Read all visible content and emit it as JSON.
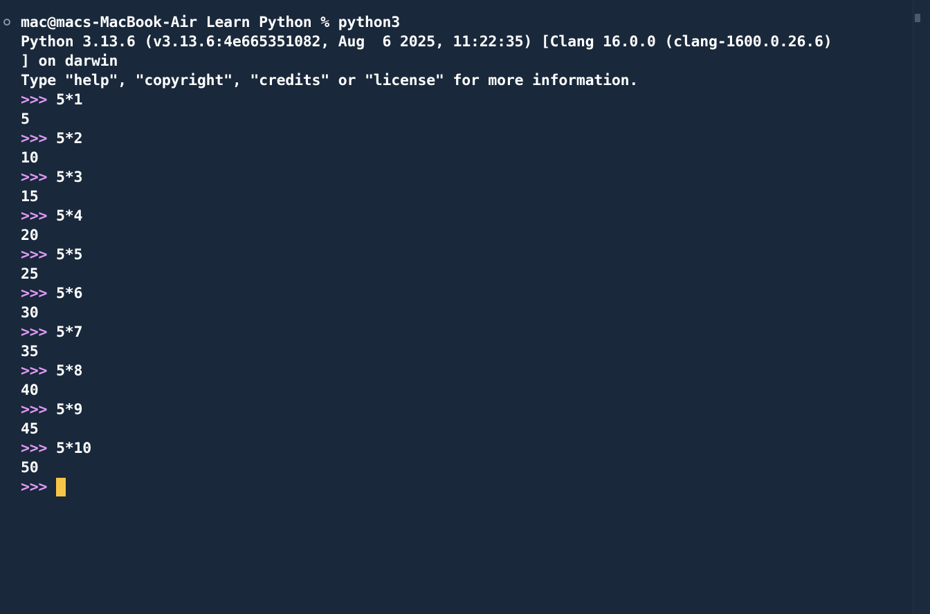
{
  "terminal": {
    "shell_prompt": "mac@macs-MacBook-Air Learn Python % python3",
    "banner_line1": "Python 3.13.6 (v3.13.6:4e665351082, Aug  6 2025, 11:22:35) [Clang 16.0.0 (clang-1600.0.26.6)",
    "banner_line2": "] on darwin",
    "banner_line3": "Type \"help\", \"copyright\", \"credits\" or \"license\" for more information.",
    "repl_prompt": ">>>",
    "entries": [
      {
        "input": "5*1",
        "output": "5"
      },
      {
        "input": "5*2",
        "output": "10"
      },
      {
        "input": "5*3",
        "output": "15"
      },
      {
        "input": "5*4",
        "output": "20"
      },
      {
        "input": "5*5",
        "output": "25"
      },
      {
        "input": "5*6",
        "output": "30"
      },
      {
        "input": "5*7",
        "output": "35"
      },
      {
        "input": "5*8",
        "output": "40"
      },
      {
        "input": "5*9",
        "output": "45"
      },
      {
        "input": "5*10",
        "output": "50"
      }
    ]
  },
  "colors": {
    "background": "#19283a",
    "text": "#ffffff",
    "prompt": "#e09af7",
    "cursor": "#f6c548"
  }
}
